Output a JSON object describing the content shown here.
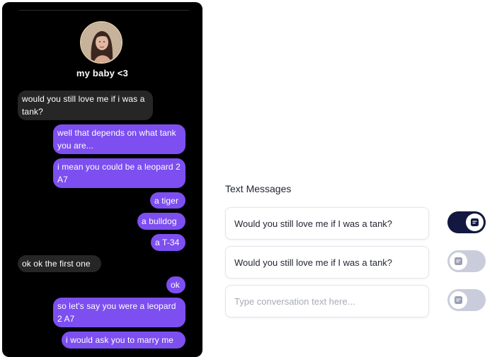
{
  "chat": {
    "contact_name": "my baby <3",
    "messages": [
      {
        "side": "in",
        "text": "would you still love me if i was a tank?"
      },
      {
        "side": "out",
        "text": "well that depends on what tank you are..."
      },
      {
        "side": "out",
        "text": "i mean you could be a leopard 2 A7"
      },
      {
        "side": "out",
        "text": "a tiger"
      },
      {
        "side": "out",
        "text": "a bulldog"
      },
      {
        "side": "out",
        "text": "a T-34"
      },
      {
        "side": "in",
        "text": "ok ok the first one"
      },
      {
        "side": "out",
        "text": "ok"
      },
      {
        "side": "out",
        "text": "so let's say you were a leopard 2 A7"
      },
      {
        "side": "out",
        "text": "i would ask you to marry me"
      }
    ]
  },
  "settings": {
    "title": "Text Messages",
    "fields": [
      {
        "value": "Would you still love me if I was a tank?",
        "placeholder": "",
        "toggle_on": true
      },
      {
        "value": "Would you still love me if I was a tank?",
        "placeholder": "",
        "toggle_on": false
      },
      {
        "value": "",
        "placeholder": "Type conversation text here...",
        "toggle_on": false
      }
    ]
  },
  "colors": {
    "incoming_bubble": "#262626",
    "outgoing_bubble": "#7d4ff0",
    "toggle_on": "#12183f",
    "toggle_off": "#c9cddb"
  },
  "icons": {
    "toggle_knob": "message-icon"
  }
}
